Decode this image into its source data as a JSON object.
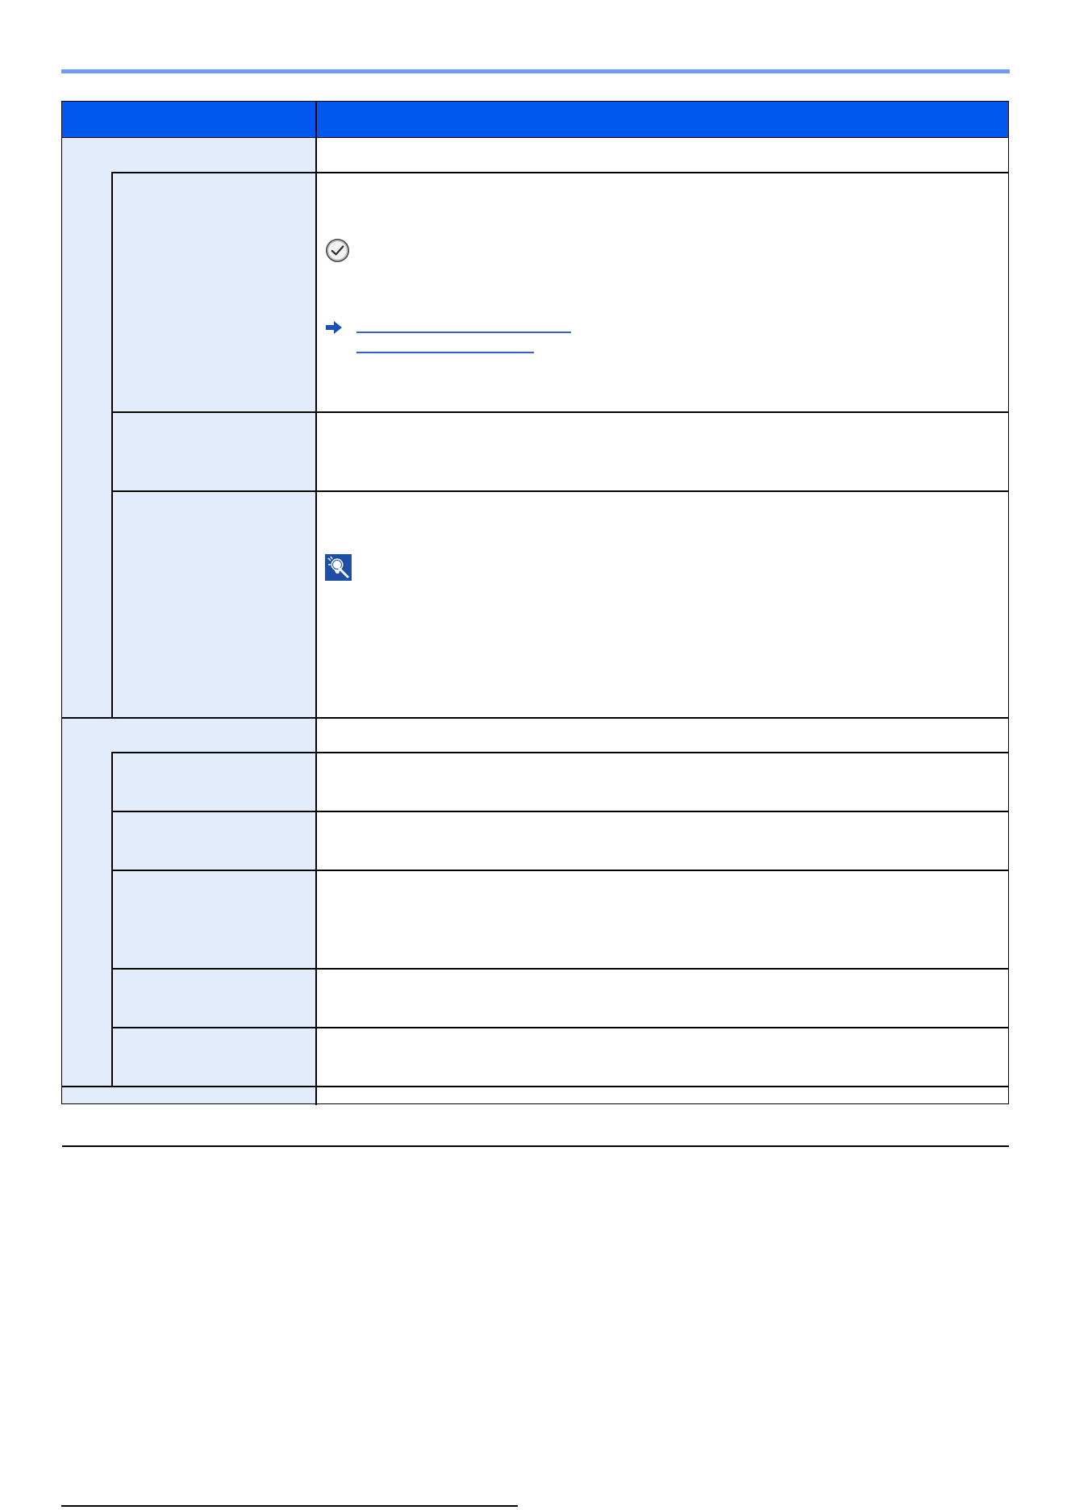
{
  "document": {
    "header": {
      "left_label": "",
      "right_label": ""
    },
    "rows": [
      {
        "level": 1,
        "label": "",
        "description": ""
      },
      {
        "level": 2,
        "label": "",
        "description": ""
      },
      {
        "level": 2,
        "label": "",
        "description": ""
      },
      {
        "level": 2,
        "label": "",
        "description": ""
      },
      {
        "level": 1,
        "label": "",
        "description": ""
      },
      {
        "level": 2,
        "label": "",
        "description": ""
      },
      {
        "level": 2,
        "label": "",
        "description": ""
      },
      {
        "level": 2,
        "label": "",
        "description": ""
      },
      {
        "level": 2,
        "label": "",
        "description": ""
      },
      {
        "level": 2,
        "label": "",
        "description": ""
      },
      {
        "level": 1,
        "label": "",
        "description": ""
      },
      {
        "level": 1,
        "label": "",
        "description": ""
      }
    ],
    "icons": {
      "important": "check-circle-icon",
      "reference": "arrow-right-icon",
      "tip": "lightbulb-tip-icon"
    },
    "colors": {
      "header_background": "#0058ee",
      "label_column_background": "#e3ecfb",
      "top_rule": "#6e9cf0",
      "link": "#2a5fd6"
    },
    "footer": {
      "text": ""
    }
  }
}
